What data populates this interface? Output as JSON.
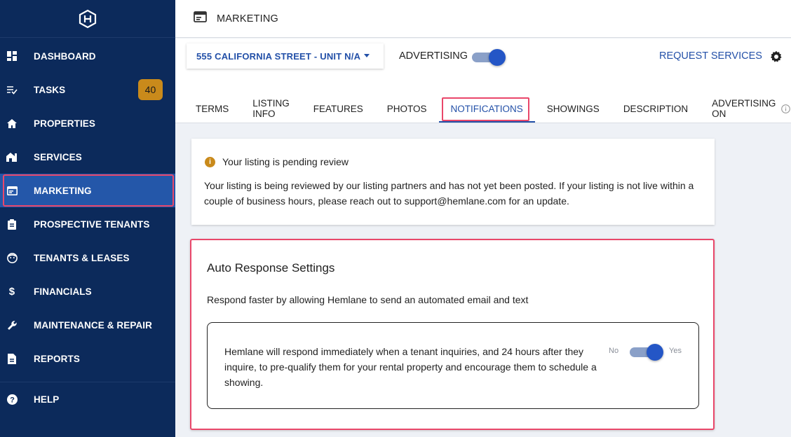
{
  "sidebar": {
    "logo": "hemlane-logo",
    "items": [
      {
        "label": "DASHBOARD",
        "icon": "dashboard-icon"
      },
      {
        "label": "TASKS",
        "icon": "tasks-icon",
        "badge": "40"
      },
      {
        "label": "PROPERTIES",
        "icon": "home-icon"
      },
      {
        "label": "SERVICES",
        "icon": "services-icon"
      },
      {
        "label": "MARKETING",
        "icon": "marketing-icon",
        "active": true
      },
      {
        "label": "PROSPECTIVE TENANTS",
        "icon": "clipboard-icon"
      },
      {
        "label": "TENANTS & LEASES",
        "icon": "tenant-face-icon"
      },
      {
        "label": "FINANCIALS",
        "icon": "dollar-icon"
      },
      {
        "label": "MAINTENANCE & REPAIR",
        "icon": "wrench-icon"
      },
      {
        "label": "REPORTS",
        "icon": "document-icon"
      }
    ],
    "help": {
      "label": "HELP",
      "icon": "help-icon"
    }
  },
  "header": {
    "title": "MARKETING",
    "icon": "marketing-window-icon"
  },
  "subbar": {
    "property": "555 CALIFORNIA STREET - UNIT N/A",
    "advertising_label": "ADVERTISING",
    "advertising_on": true,
    "request_services": "REQUEST SERVICES",
    "tabs": [
      "TERMS",
      "LISTING INFO",
      "FEATURES",
      "PHOTOS",
      "NOTIFICATIONS",
      "SHOWINGS",
      "DESCRIPTION",
      "ADVERTISING ON"
    ],
    "active_tab": "NOTIFICATIONS"
  },
  "pending": {
    "title": "Your listing is pending review",
    "body": "Your listing is being reviewed by our listing partners and has not yet been posted. If your listing is not live within a couple of business hours, please reach out to support@hemlane.com for an update."
  },
  "auto_response": {
    "title": "Auto Response Settings",
    "description": "Respond faster by allowing Hemlane to send an automated email and text",
    "setting_text": "Hemlane will respond immediately when a tenant inquiries, and 24 hours after they inquire, to pre-qualify them for your rental property and encourage them to schedule a showing.",
    "no_label": "No",
    "yes_label": "Yes",
    "enabled": true
  },
  "colors": {
    "sidebar": "#0c2a5b",
    "active": "#2457a9",
    "accent": "#2350a8",
    "highlight": "#e9476a",
    "badge": "#c98a1b"
  }
}
